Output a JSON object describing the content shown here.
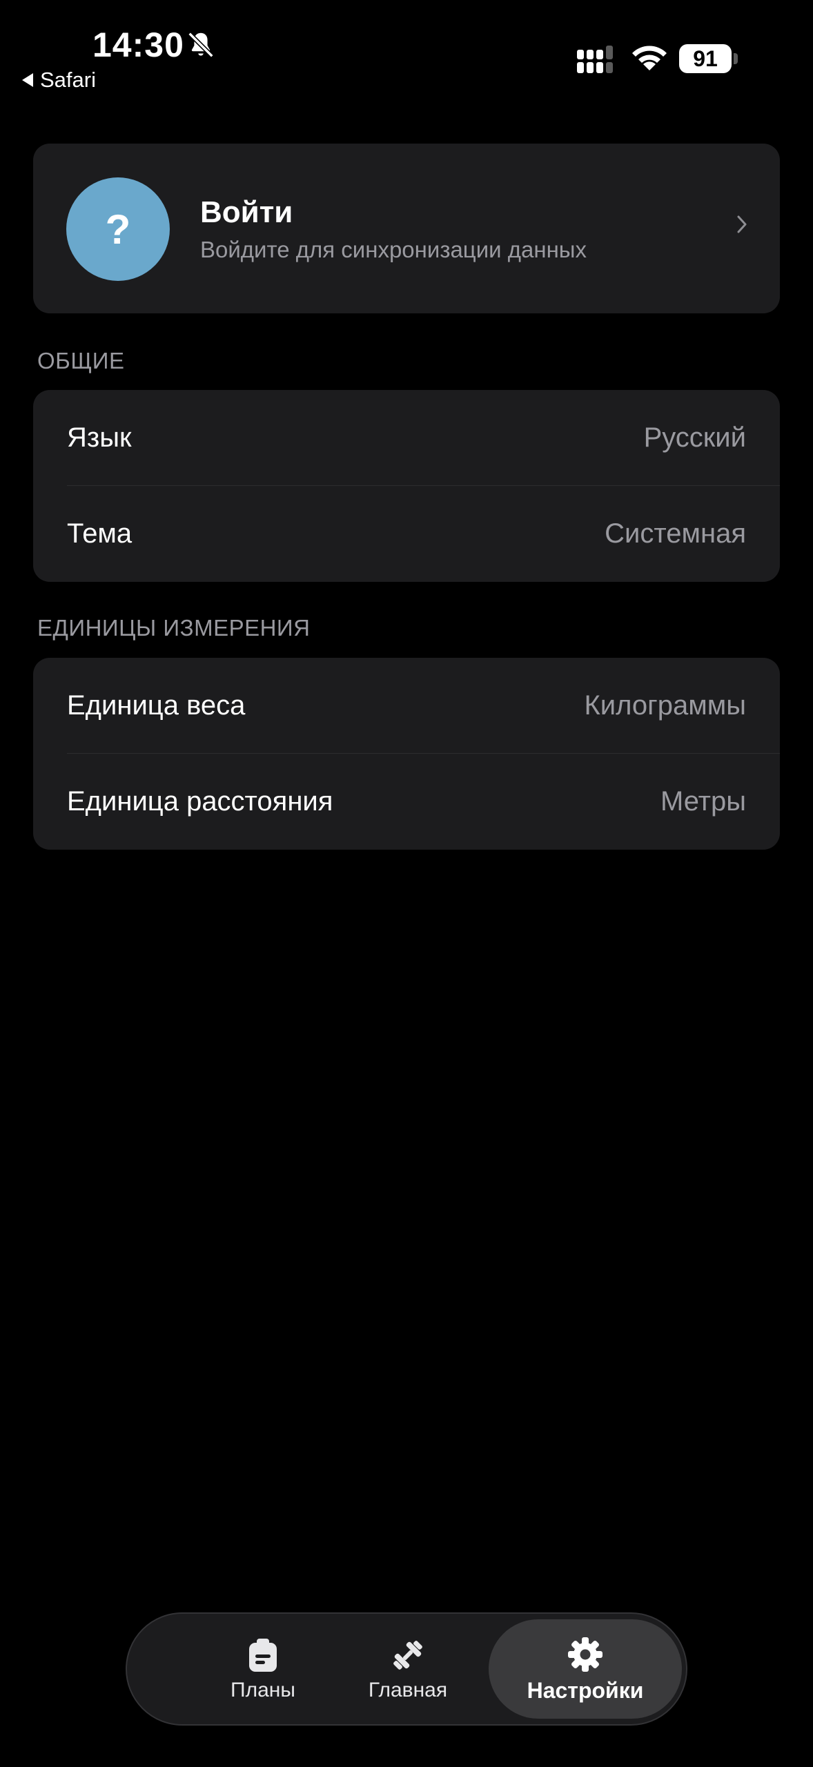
{
  "status_bar": {
    "time": "14:30",
    "back_app": "Safari",
    "battery": "91",
    "icons": [
      "bell-muted-icon",
      "cellular-signal-icon",
      "wifi-icon",
      "battery-icon"
    ]
  },
  "login": {
    "avatar_symbol": "?",
    "title": "Войти",
    "subtitle": "Войдите для синхронизации данных",
    "avatar_color": "#6aa8cc"
  },
  "sections": {
    "general": {
      "header": "ОБЩИЕ",
      "rows": [
        {
          "label": "Язык",
          "value": "Русский"
        },
        {
          "label": "Тема",
          "value": "Системная"
        }
      ]
    },
    "units": {
      "header": "ЕДИНИЦЫ ИЗМЕРЕНИЯ",
      "rows": [
        {
          "label": "Единица веса",
          "value": "Килограммы"
        },
        {
          "label": "Единица расстояния",
          "value": "Метры"
        }
      ]
    }
  },
  "tab_bar": {
    "tabs": [
      {
        "label": "Планы",
        "icon": "clipboard-icon",
        "active": false
      },
      {
        "label": "Главная",
        "icon": "dumbbell-icon",
        "active": false
      },
      {
        "label": "Настройки",
        "icon": "gear-icon",
        "active": true
      }
    ]
  },
  "colors": {
    "background": "#000000",
    "card": "#1c1c1e",
    "secondary_text": "#9a9aa0",
    "active_tab": "#3a3a3c"
  }
}
